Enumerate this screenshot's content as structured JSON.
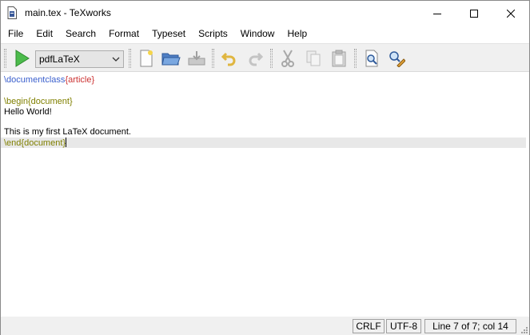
{
  "window": {
    "title": "main.tex - TeXworks",
    "minimize_icon": "minimize-icon",
    "maximize_icon": "maximize-icon",
    "close_icon": "close-icon"
  },
  "menu": {
    "items": [
      "File",
      "Edit",
      "Search",
      "Format",
      "Typeset",
      "Scripts",
      "Window",
      "Help"
    ]
  },
  "toolbar": {
    "engine_selected": "pdfLaTeX",
    "icons": [
      "typeset-play-icon",
      "new-document-icon",
      "open-folder-icon",
      "save-icon",
      "undo-icon",
      "redo-icon",
      "cut-icon",
      "copy-icon",
      "paste-icon",
      "find-icon",
      "go-to-pdf-icon"
    ],
    "accent_play": "#3aa63a"
  },
  "editor": {
    "lines": [
      {
        "cmd": "\\documentclass",
        "arg": "{article}"
      },
      {
        "text": ""
      },
      {
        "env": "\\begin{document}"
      },
      {
        "text": "Hello World!"
      },
      {
        "text": ""
      },
      {
        "text": "This is my first LaTeX document."
      },
      {
        "env": "\\end{document}"
      }
    ],
    "colors": {
      "command": "#3a5fcd",
      "argument": "#cc3333",
      "environment": "#808000",
      "current_line": "#e8e8e8"
    }
  },
  "status": {
    "line_ending": "CRLF",
    "encoding": "UTF-8",
    "position": "Line 7 of 7; col 14"
  }
}
